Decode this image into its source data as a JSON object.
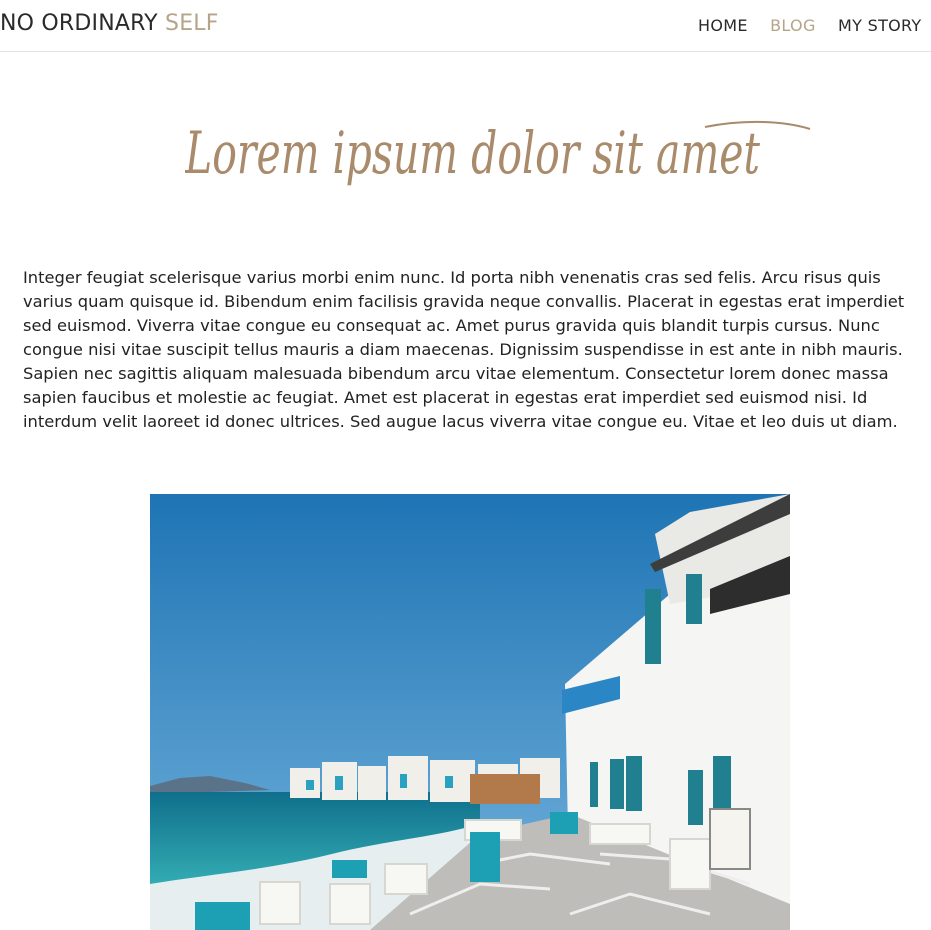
{
  "header": {
    "logo_main": "NO ORDINARY",
    "logo_accent": "SELF",
    "nav": [
      "HOME",
      "BLOG",
      "MY STORY"
    ],
    "active_nav": "BLOG"
  },
  "hero": {
    "script_title": "Lorem ipsum dolor sit amet"
  },
  "article": {
    "paragraph": "Integer feugiat scelerisque varius morbi enim nunc. Id porta nibh venenatis cras sed felis. Arcu risus quis varius quam quisque id. Bibendum enim facilisis gravida neque convallis. Placerat in egestas erat imperdiet sed euismod. Viverra vitae congue eu consequat ac. Amet purus gravida quis blandit turpis cursus. Nunc congue nisi vitae suscipit tellus mauris a diam maecenas. Dignissim suspendisse in est ante in nibh mauris. Sapien nec sagittis aliquam malesuada bibendum arcu vitae elementum. Consectetur lorem donec massa sapien faucibus et molestie ac feugiat. Amet est placerat in egestas erat imperdiet sed euismod nisi. Id interdum velit laoreet id donec ultrices. Sed augue lacus viverra vitae congue eu. Vitae et leo duis ut diam."
  },
  "colors": {
    "accent": "#b5a488",
    "script": "#a98a6a",
    "sky": "#2f86c4",
    "sea": "#1f8ea5"
  }
}
